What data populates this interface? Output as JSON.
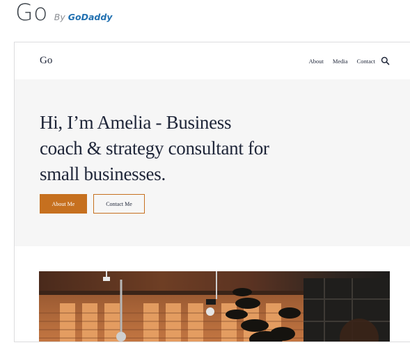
{
  "theme": {
    "name": "Go",
    "by_label": "By",
    "author": "GoDaddy"
  },
  "site": {
    "title": "Go",
    "nav": [
      {
        "label": "About"
      },
      {
        "label": "Media"
      },
      {
        "label": "Contact"
      }
    ],
    "search_icon": "search-icon"
  },
  "hero": {
    "heading": "Hi, I’m Amelia - Business coach & strategy consultant for small businesses.",
    "primary_button": "About Me",
    "secondary_button": "Contact Me"
  },
  "colors": {
    "accent": "#c6701f",
    "text": "#1e2538",
    "hero_bg": "#f6f6f6",
    "link": "#2271b1"
  }
}
